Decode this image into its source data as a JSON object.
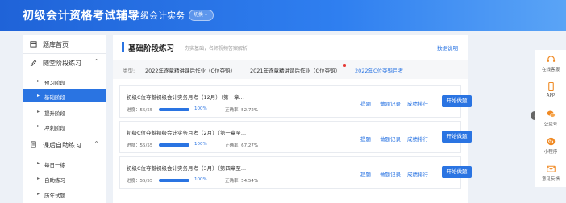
{
  "header": {
    "title": "初级会计资格考试辅导",
    "subject": "初级会计实务",
    "switch_label": "切换"
  },
  "sidebar": {
    "home": "题库首页",
    "group1": "随堂阶段练习",
    "group1_items": [
      "预习阶段",
      "基础阶段",
      "提升阶段",
      "冲刺阶段"
    ],
    "group2": "课后自助练习",
    "group2_items": [
      "每日一练",
      "自助练习",
      "历年试题"
    ]
  },
  "main": {
    "title": "基础阶段练习",
    "desc": "夯实基础，名师视频答案解析",
    "data_explain": "数据说明",
    "filter_label": "类型:",
    "filter_options": [
      "2022年逐章精讲课后作业（C位夺魁）",
      "2021年逐章精讲课后作业（C位夺魁）",
      "2022年C位夺魁月考"
    ],
    "links": {
      "ask": "提题",
      "record": "做题记录",
      "rank": "成绩排行"
    },
    "start_label": "开始做题",
    "progress_label": "进度：",
    "cards": [
      {
        "title": "初级C位夺魁初级会计实务月考（12月）（第一章...",
        "progress": "55/55",
        "percent": "100%",
        "percent_value": 100,
        "accuracy": "正确率: 52.72%"
      },
      {
        "title": "初级C位夺魁初级会计实务月考（2月）（第一章至...",
        "progress": "55/55",
        "percent": "100%",
        "percent_value": 100,
        "accuracy": "正确率: 67.27%"
      },
      {
        "title": "初级C位夺魁初级会计实务月考（3月）（第四章至...",
        "progress": "55/55",
        "percent": "100%",
        "percent_value": 100,
        "accuracy": "正确率: 54.54%"
      }
    ]
  },
  "rail": [
    "在线客服",
    "APP",
    "公众号",
    "小程序",
    "意见反馈"
  ],
  "colors": {
    "primary": "#2a74e2",
    "header_start": "#1f63d8",
    "badge_red": "#e53935"
  }
}
